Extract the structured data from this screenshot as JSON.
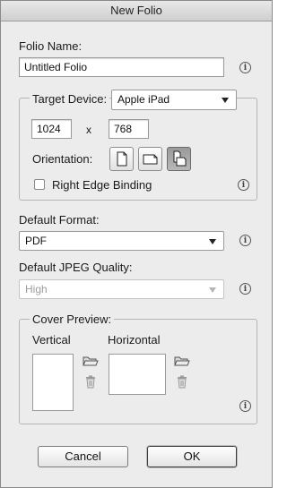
{
  "window": {
    "title": "New Folio"
  },
  "folio_name": {
    "label": "Folio Name:",
    "value": "Untitled Folio"
  },
  "target_device": {
    "label": "Target Device:",
    "selected": "Apple iPad",
    "width": "1024",
    "separator": "x",
    "height": "768",
    "orientation_label": "Orientation:",
    "orientation_buttons": [
      "portrait-icon",
      "landscape-icon",
      "both-orientations-icon"
    ],
    "orientation_selected": "both-orientations-icon",
    "right_edge_binding": {
      "label": "Right Edge Binding",
      "checked": false
    }
  },
  "default_format": {
    "label": "Default Format:",
    "selected": "PDF"
  },
  "default_jpeg_quality": {
    "label": "Default JPEG Quality:",
    "selected": "High",
    "disabled": true
  },
  "cover_preview": {
    "label": "Cover Preview:",
    "vertical_label": "Vertical",
    "horizontal_label": "Horizontal"
  },
  "buttons": {
    "cancel": "Cancel",
    "ok": "OK"
  },
  "info_icon_glyph": "i",
  "colors": {
    "window_bg": "#ececec",
    "active_toggle": "#9a9a9a",
    "disabled_text": "#9c9c9c"
  }
}
